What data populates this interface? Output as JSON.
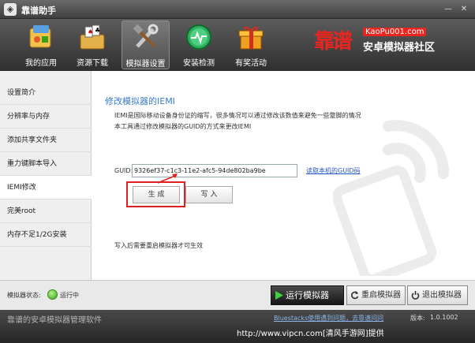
{
  "window": {
    "title": "靠谱助手",
    "icon_glyph": "◈",
    "min_glyph": "—",
    "close_glyph": "✕"
  },
  "toolbar": {
    "items": [
      {
        "label": "我的应用",
        "icon": "my-apps-icon"
      },
      {
        "label": "资源下载",
        "icon": "resource-download-icon"
      },
      {
        "label": "模拟器设置",
        "icon": "emulator-settings-icon",
        "active": true
      },
      {
        "label": "安装检测",
        "icon": "install-check-icon"
      },
      {
        "label": "有奖活动",
        "icon": "gift-icon"
      }
    ]
  },
  "brand": {
    "cn": "靠谱",
    "url": "KaoPu001.com",
    "sub": "安卓模拟器社区",
    "color": "#e8251f"
  },
  "sidebar": {
    "items": [
      {
        "label": "设置简介"
      },
      {
        "label": "分辨率与内存"
      },
      {
        "label": "添加共享文件夹"
      },
      {
        "label": "重力键脚本导入"
      },
      {
        "label": "IEMI修改",
        "active": true
      },
      {
        "label": "完美root"
      },
      {
        "label": "内存不足1/2G安装"
      }
    ]
  },
  "main": {
    "heading": "修改模拟器的IEMI",
    "desc1": "IEMI是国际移动设备身份证的缩写，很多情况可以通过修改该数值来避免一些蹩脚的情况",
    "desc2": "本工具通过修改模拟器的GUID的方式来更改IEMI",
    "guid_label": "GUID:",
    "guid_value": "9326ef37-c1c3-11e2-afc5-94de802ba9be",
    "read_link": "读取本机的GUID码",
    "generate_btn": "生 成",
    "write_btn": "写 入",
    "note": "写入后需要重启模拟器才可生效"
  },
  "status": {
    "label": "模拟器状态:",
    "state": "运行中",
    "run_btn": "运行模拟器",
    "restart_btn": "重启模拟器",
    "quit_btn": "退出模拟器"
  },
  "footer": {
    "left": "靠谱的安卓模拟器管理软件",
    "link": "Bluestacks使用遇到问题，去靠谱问问",
    "version_label": "版本:",
    "version": "1.0.1002"
  },
  "watermark": "http://www.vipcn.com[清风手游网]提供",
  "colors": {
    "accent": "#3a7bc8",
    "highlight": "#e02020",
    "link": "#2255cc",
    "status_green": "#3aa016"
  }
}
